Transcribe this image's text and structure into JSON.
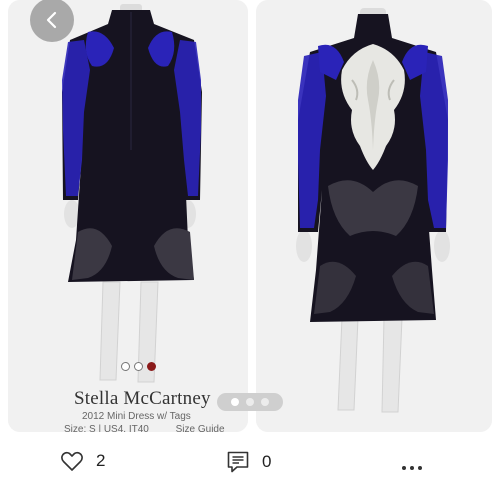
{
  "product": {
    "brand": "Stella McCartney",
    "subtitle": "2012 Mini Dress w/ Tags",
    "size_text": "Size: S | US4, IT40",
    "size_guide": "Size Guide"
  },
  "carousel": {
    "total_images": 3,
    "active_index": 3,
    "pager_total": 3,
    "pager_active": 1
  },
  "actions": {
    "like_count": "2",
    "comment_count": "0"
  },
  "colors": {
    "dress_black": "#161320",
    "embroidery_blue": "#2a23b8",
    "embroidery_white": "#e7e7e3",
    "active_dot": "#8b1a1a",
    "back_button_bg": "#a9a9a9"
  },
  "icons": [
    "chevron-left-icon",
    "heart-icon",
    "comment-icon",
    "more-icon"
  ]
}
